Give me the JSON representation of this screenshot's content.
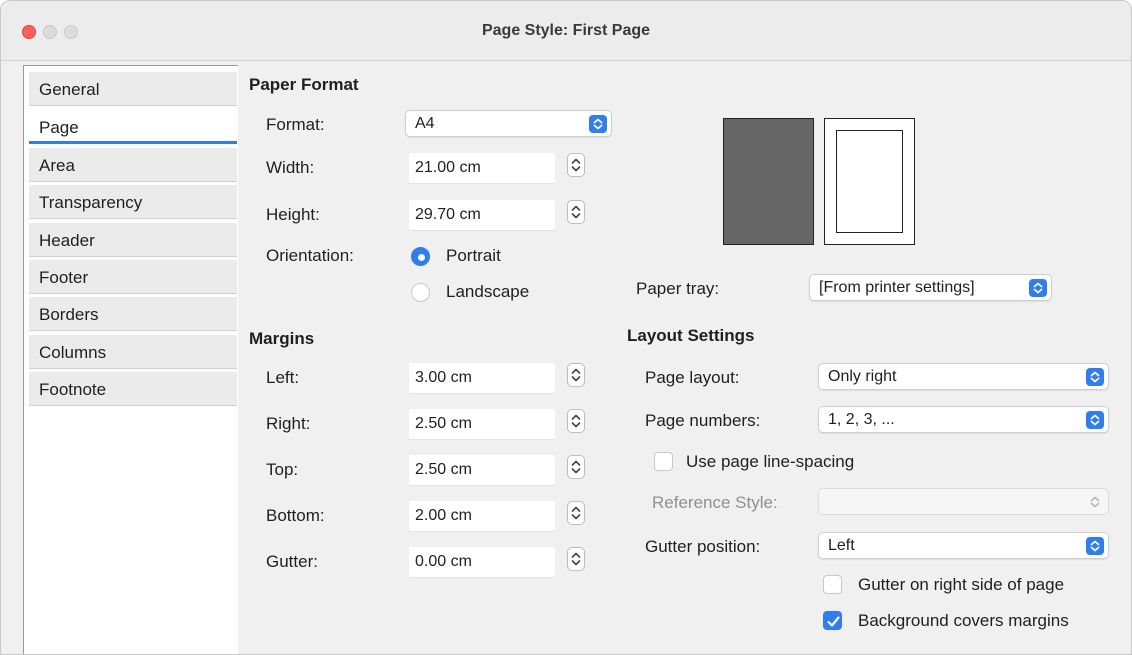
{
  "window": {
    "title": "Page Style: First Page"
  },
  "sidebar": {
    "items": [
      {
        "label": "General"
      },
      {
        "label": "Page"
      },
      {
        "label": "Area"
      },
      {
        "label": "Transparency"
      },
      {
        "label": "Header"
      },
      {
        "label": "Footer"
      },
      {
        "label": "Borders"
      },
      {
        "label": "Columns"
      },
      {
        "label": "Footnote"
      }
    ],
    "active": "Page"
  },
  "paper_format": {
    "heading": "Paper Format",
    "format_label": "Format:",
    "format_value": "A4",
    "width_label": "Width:",
    "width_value": "21.00 cm",
    "height_label": "Height:",
    "height_value": "29.70 cm",
    "orientation_label": "Orientation:",
    "portrait_label": "Portrait",
    "landscape_label": "Landscape",
    "orientation_selected": "Portrait",
    "paper_tray_label": "Paper tray:",
    "paper_tray_value": "[From printer settings]"
  },
  "margins": {
    "heading": "Margins",
    "left_label": "Left:",
    "left_value": "3.00 cm",
    "right_label": "Right:",
    "right_value": "2.50 cm",
    "top_label": "Top:",
    "top_value": "2.50 cm",
    "bottom_label": "Bottom:",
    "bottom_value": "2.00 cm",
    "gutter_label": "Gutter:",
    "gutter_value": "0.00 cm"
  },
  "layout_settings": {
    "heading": "Layout Settings",
    "page_layout_label": "Page layout:",
    "page_layout_value": "Only right",
    "page_numbers_label": "Page numbers:",
    "page_numbers_value": "1, 2, 3, ...",
    "use_line_spacing_label": "Use page line-spacing",
    "use_line_spacing_checked": false,
    "reference_style_label": "Reference Style:",
    "reference_style_value": "",
    "gutter_position_label": "Gutter position:",
    "gutter_position_value": "Left",
    "gutter_right_label": "Gutter on right side of page",
    "gutter_right_checked": false,
    "background_covers_label": "Background covers margins",
    "background_covers_checked": true
  },
  "colors": {
    "accent": "#2f7df6",
    "close": "#fe5f57",
    "preview_fill": "#666666"
  }
}
